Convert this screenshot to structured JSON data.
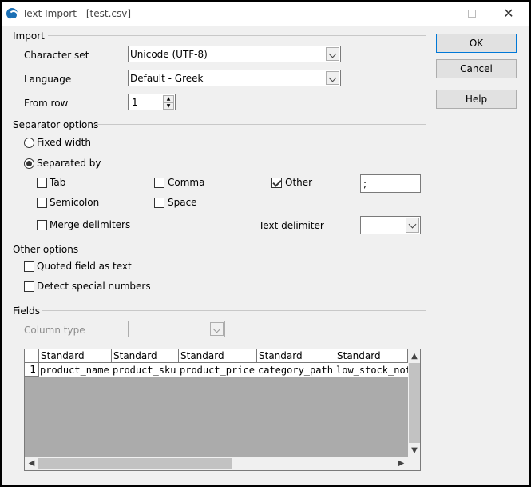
{
  "window": {
    "title": "Text Import - [test.csv]",
    "minimize": "—",
    "close": "✕"
  },
  "import_section": {
    "title": "Import",
    "charset_label": "Character set",
    "charset_value": "Unicode (UTF-8)",
    "language_label": "Language",
    "language_value": "Default - Greek",
    "from_row_label": "From row",
    "from_row_value": "1"
  },
  "separator_section": {
    "title": "Separator options",
    "fixed_width": "Fixed width",
    "separated_by": "Separated by",
    "selected_mode": "separated_by",
    "tab": "Tab",
    "tab_checked": false,
    "comma": "Comma",
    "comma_checked": false,
    "other": "Other",
    "other_checked": true,
    "other_value": ";",
    "semicolon": "Semicolon",
    "semicolon_checked": false,
    "space": "Space",
    "space_checked": false,
    "merge": "Merge delimiters",
    "merge_checked": false,
    "text_delim_label": "Text delimiter",
    "text_delim_value": ""
  },
  "other_section": {
    "title": "Other options",
    "quoted": "Quoted field as text",
    "quoted_checked": false,
    "detect": "Detect special numbers",
    "detect_checked": false
  },
  "fields_section": {
    "title": "Fields",
    "column_type_label": "Column type",
    "column_type_value": "",
    "headers": [
      "Standard",
      "Standard",
      "Standard",
      "Standard",
      "Standard"
    ],
    "rows": [
      {
        "num": "1",
        "cells": [
          "product_name",
          "product_sku",
          "product_price",
          "category_path",
          "low_stock_not"
        ]
      }
    ]
  },
  "buttons": {
    "ok": "OK",
    "cancel": "Cancel",
    "help": "Help"
  },
  "colors": {
    "dialog_bg": "#f0f0f0",
    "preview_empty": "#ababab",
    "default_button_border": "#0078d7"
  }
}
